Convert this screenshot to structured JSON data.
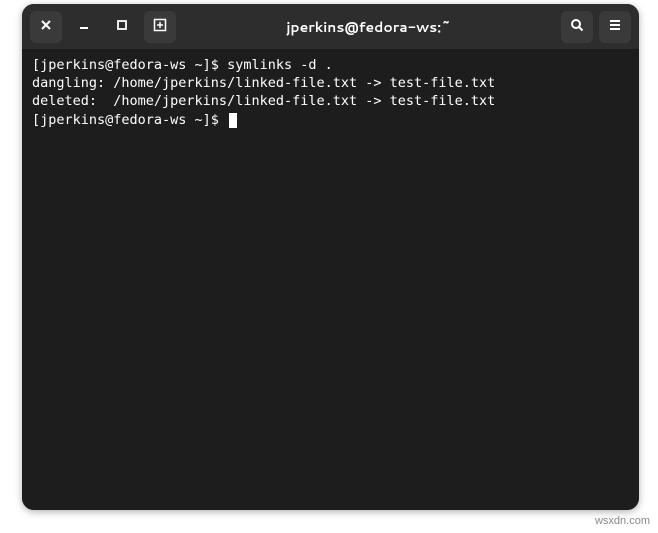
{
  "window": {
    "title": "jperkins@fedora-ws:~"
  },
  "terminal": {
    "lines": [
      {
        "prompt": "[jperkins@fedora-ws ~]$ ",
        "command": "symlinks -d ."
      },
      {
        "text": "dangling: /home/jperkins/linked-file.txt -> test-file.txt"
      },
      {
        "text": "deleted:  /home/jperkins/linked-file.txt -> test-file.txt"
      },
      {
        "prompt": "[jperkins@fedora-ws ~]$ ",
        "command": "",
        "cursor": true
      }
    ]
  },
  "watermark": "wsxdn.com"
}
